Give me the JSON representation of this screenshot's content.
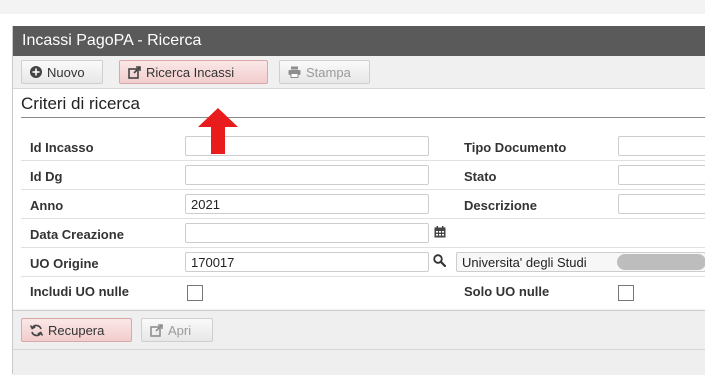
{
  "window": {
    "title": "Incassi PagoPA - Ricerca"
  },
  "toolbar": {
    "nuovo_label": "Nuovo",
    "ricerca_incassi_label": "Ricerca Incassi",
    "stampa_label": "Stampa"
  },
  "form": {
    "section_title": "Criteri di ricerca",
    "id_incasso": {
      "label": "Id Incasso",
      "value": ""
    },
    "id_dg": {
      "label": "Id Dg",
      "value": ""
    },
    "anno": {
      "label": "Anno",
      "value": "2021"
    },
    "data_creazione": {
      "label": "Data Creazione",
      "value": ""
    },
    "uo_origine": {
      "label": "UO Origine",
      "value": "170017",
      "description": "Universita' degli Studi"
    },
    "includi_uo_nulle": {
      "label": "Includi UO nulle",
      "checked": false
    },
    "tipo_documento": {
      "label": "Tipo Documento",
      "value": ""
    },
    "stato": {
      "label": "Stato",
      "value": ""
    },
    "descrizione": {
      "label": "Descrizione",
      "value": ""
    },
    "solo_uo_nulle": {
      "label": "Solo UO nulle",
      "checked": false
    }
  },
  "footer": {
    "recupera_label": "Recupera",
    "apri_label": "Apri"
  },
  "colors": {
    "title_bar": "#5a5a5a",
    "pink_button": "#f2cdcd",
    "annotation_arrow": "#e81c1c"
  }
}
